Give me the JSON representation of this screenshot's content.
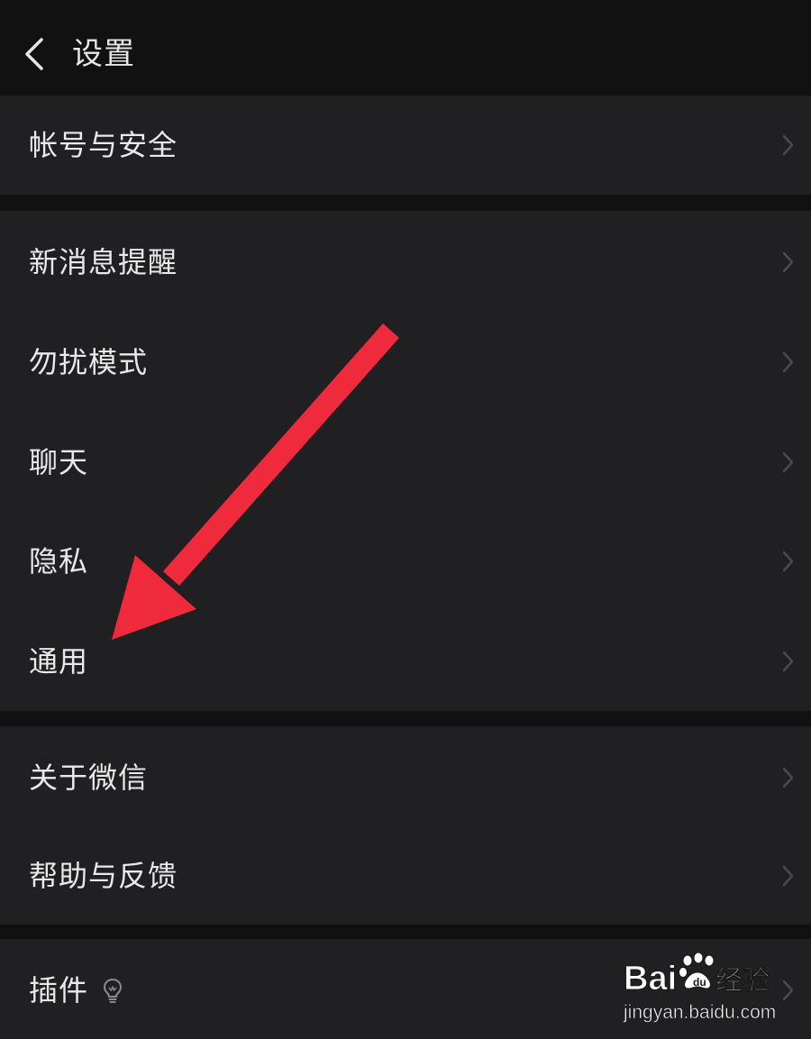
{
  "header": {
    "title": "设置",
    "back_icon": "chevron-left-icon"
  },
  "groups": [
    {
      "items": [
        {
          "label": "帐号与安全"
        }
      ]
    },
    {
      "items": [
        {
          "label": "新消息提醒"
        },
        {
          "label": "勿扰模式"
        },
        {
          "label": "聊天"
        },
        {
          "label": "隐私"
        },
        {
          "label": "通用"
        }
      ]
    },
    {
      "items": [
        {
          "label": "关于微信"
        },
        {
          "label": "帮助与反馈"
        }
      ]
    },
    {
      "items": [
        {
          "label": "插件",
          "icon": "lightbulb-icon"
        }
      ]
    }
  ],
  "annotation": {
    "arrow_color": "#ee2a3c",
    "points_to": "通用"
  },
  "watermark": {
    "brand_left": "Bai",
    "brand_right": "经验",
    "url": "jingyan.baidu.com"
  },
  "colors": {
    "background": "#111111",
    "cell": "#202022",
    "text": "#e9e9e9",
    "chevron": "#4a4a4c"
  }
}
